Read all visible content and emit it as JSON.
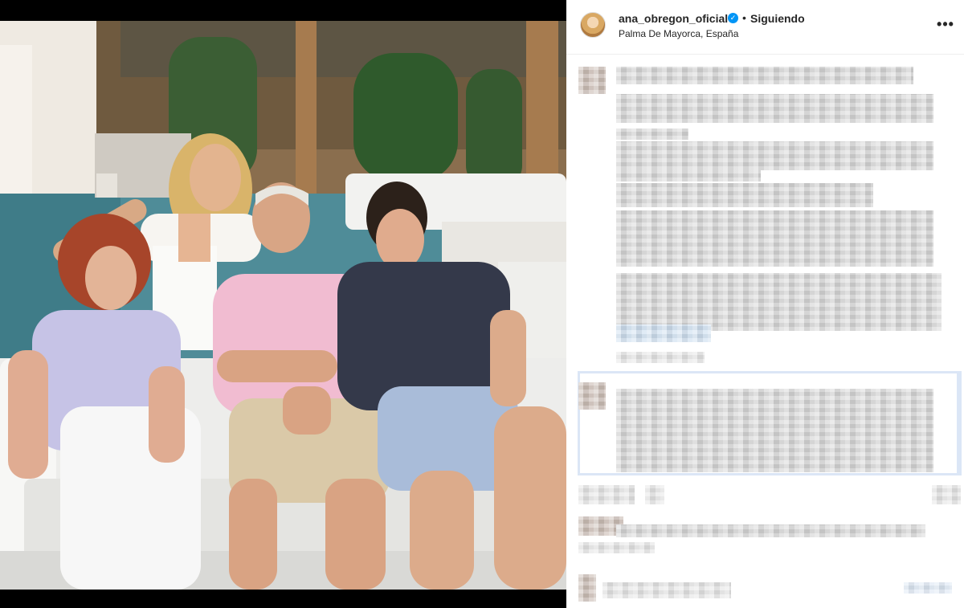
{
  "post": {
    "username": "ana_obregon_oficial",
    "verified_icon": "verified-badge-icon",
    "separator": "•",
    "follow_status": "Siguiendo",
    "location": "Palma De Mayorca, España",
    "more_icon": "more-options-icon",
    "more_glyph": "•••"
  },
  "colors": {
    "accent": "#0095f6",
    "text": "#262626",
    "divider": "#efefef"
  }
}
